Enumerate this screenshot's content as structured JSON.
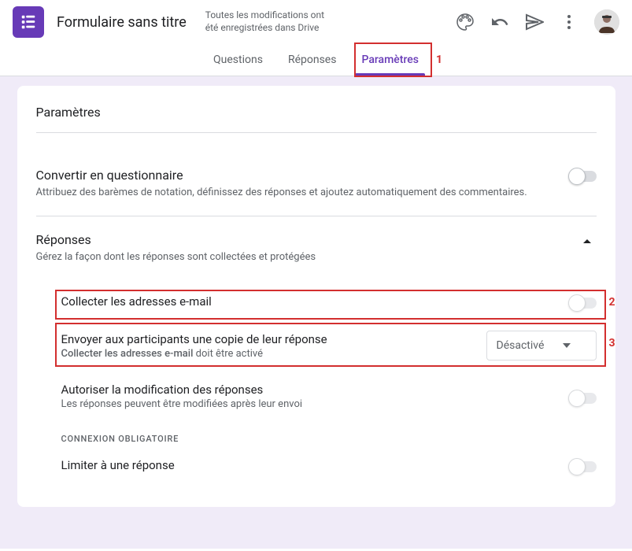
{
  "header": {
    "title": "Formulaire sans titre",
    "saveStatus": "Toutes les modifications ont été enregistrées dans Drive"
  },
  "tabs": {
    "questions": "Questions",
    "responses": "Réponses",
    "settings": "Paramètres"
  },
  "annotations": {
    "label1": "1",
    "label2": "2",
    "label3": "3"
  },
  "card": {
    "title": "Paramètres",
    "quiz": {
      "title": "Convertir en questionnaire",
      "desc": "Attribuez des barèmes de notation, définissez des réponses et ajoutez automatiquement des commentaires."
    },
    "responses": {
      "title": "Réponses",
      "desc": "Gérez la façon dont les réponses sont collectées et protégées",
      "collectEmail": "Collecter les adresses e-mail",
      "sendCopy": {
        "title": "Envoyer aux participants une copie de leur réponse",
        "descPrefix": "Collecter les adresses e-mail",
        "descSuffix": " doit être activé",
        "dropdown": "Désactivé"
      },
      "allowEdit": {
        "title": "Autoriser la modification des réponses",
        "desc": "Les réponses peuvent être modifiées après leur envoi"
      },
      "loginSection": "CONNEXION OBLIGATOIRE",
      "limitOne": "Limiter à une réponse"
    }
  }
}
